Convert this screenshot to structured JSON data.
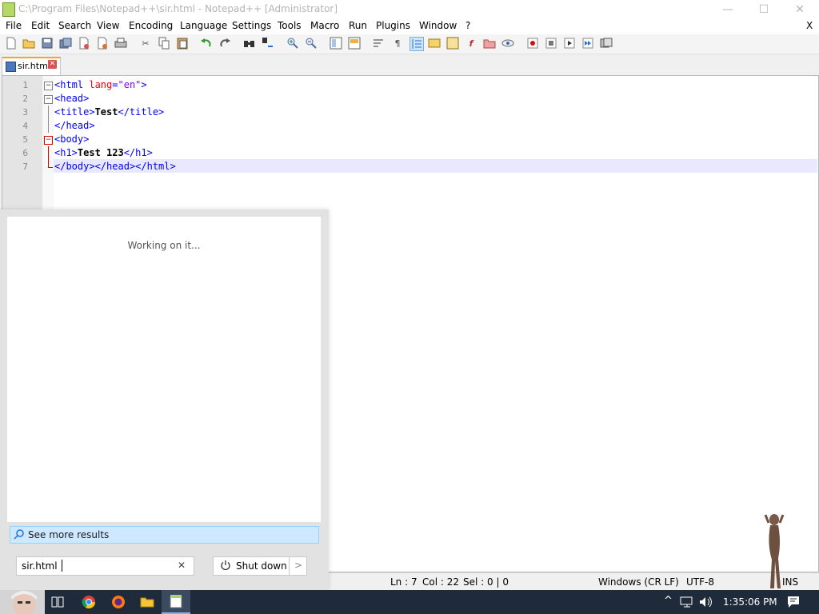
{
  "window": {
    "title": "C:\\Program Files\\Notepad++\\sir.html - Notepad++ [Administrator]",
    "minimize_glyph": "—",
    "maximize_glyph": "☐",
    "close_glyph": "✕"
  },
  "menubar": {
    "items": [
      "File",
      "Edit",
      "Search",
      "View",
      "Encoding",
      "Language",
      "Settings",
      "Tools",
      "Macro",
      "Run",
      "Plugins",
      "Window",
      "?"
    ],
    "close_glyph": "X"
  },
  "toolbar": {
    "icons": [
      "new-file",
      "open-file",
      "save",
      "save-all",
      "close",
      "close-all",
      "print",
      "cut",
      "copy",
      "paste",
      "undo",
      "redo",
      "find",
      "replace",
      "zoom-in",
      "zoom-out",
      "sync-vertical",
      "sync-horizontal",
      "word-wrap",
      "show-all-chars",
      "indent-guide",
      "user-defined-language",
      "document-map",
      "function-list",
      "folder-as-workspace",
      "monitoring",
      "record-macro",
      "stop-recording",
      "playback-macro",
      "run-macro-multiple",
      "save-macro"
    ]
  },
  "tab": {
    "label": "sir.html",
    "close_glyph": "✕"
  },
  "editor": {
    "line_numbers": [
      "1",
      "2",
      "3",
      "4",
      "5",
      "6",
      "7"
    ],
    "lines": [
      [
        {
          "t": "<html ",
          "c": "tag"
        },
        {
          "t": "lang",
          "c": "attr"
        },
        {
          "t": "=",
          "c": "tag"
        },
        {
          "t": "\"en\"",
          "c": "str"
        },
        {
          "t": ">",
          "c": "tag"
        }
      ],
      [
        {
          "t": "<head>",
          "c": "tag"
        }
      ],
      [
        {
          "t": "<title>",
          "c": "tag"
        },
        {
          "t": "Test",
          "c": "txt"
        },
        {
          "t": "</title>",
          "c": "tag"
        }
      ],
      [
        {
          "t": "</head>",
          "c": "tag"
        }
      ],
      [
        {
          "t": "<body>",
          "c": "tag"
        }
      ],
      [
        {
          "t": "<h1>",
          "c": "tag"
        },
        {
          "t": "Test 123",
          "c": "txt"
        },
        {
          "t": "</h1>",
          "c": "tag"
        }
      ],
      [
        {
          "t": "</body></head></html>",
          "c": "tag"
        }
      ]
    ]
  },
  "statusbar": {
    "line": "Ln : 7",
    "col": "Col : 22",
    "sel": "Sel : 0 | 0",
    "eol": "Windows (CR LF)",
    "encoding": "UTF-8",
    "mode": "INS"
  },
  "start_search": {
    "working_text": "Working on it...",
    "see_more": "See more results",
    "query": "sir.html",
    "clear_glyph": "✕",
    "shutdown_label": "Shut down",
    "shutdown_arrow": ">"
  },
  "taskbar": {
    "apps": [
      "task-view",
      "chrome",
      "firefox",
      "file-explorer",
      "notepad-plus-plus"
    ],
    "clock": "1:35:06 PM",
    "tray_chevron": "^"
  },
  "colors": {
    "tab_accent": "#f5a623",
    "tag": "#0000ff",
    "attribute": "#ff0000",
    "string": "#8000ff",
    "current_line": "#e8e8ff",
    "taskbar": "#1f2b3a",
    "see_more_highlight": "#cde8ff"
  }
}
